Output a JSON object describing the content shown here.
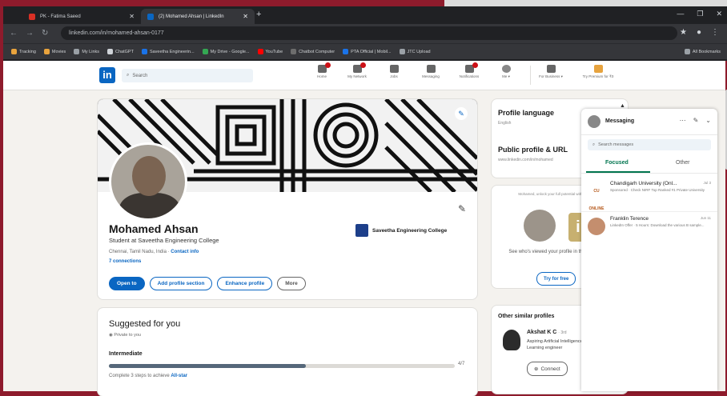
{
  "browser": {
    "tabs": [
      {
        "title": "PK - Fatima Saeed",
        "active": false,
        "color": "#d93025"
      },
      {
        "title": "(2) Mohamed Ahsan | LinkedIn",
        "active": true,
        "color": "#0a66c2"
      }
    ],
    "url": "linkedin.com/in/mohamed-ahsan-0177",
    "bookmarks": [
      "Tracking",
      "Movies",
      "My Links",
      "ChatGPT",
      "Saveetha Engineerin...",
      "My Drive - Google...",
      "YouTube",
      "Chatbot Computer",
      "PTA Official | Mobil...",
      "JTC Upload"
    ],
    "bookmarks_right": "All Bookmarks"
  },
  "linkedin": {
    "logo": "in",
    "search_placeholder": "Search",
    "nav": [
      {
        "label": "Home",
        "badge": true
      },
      {
        "label": "My Network",
        "badge": true
      },
      {
        "label": "Jobs",
        "badge": false
      },
      {
        "label": "Messaging",
        "badge": false
      },
      {
        "label": "Notifications",
        "badge": true
      },
      {
        "label": "Me ▾",
        "badge": false
      },
      {
        "label": "For Business ▾",
        "badge": false
      },
      {
        "label": "Try Premium for ₹0",
        "badge": false
      }
    ],
    "profile": {
      "name": "Mohamed Ahsan",
      "headline": "Student at Saveetha Engineering College",
      "location": "Chennai, Tamil Nadu, India ·",
      "contact_info": "Contact info",
      "connections": "7 connections",
      "college": "Saveetha Engineering College",
      "buttons": [
        "Open to",
        "Add profile section",
        "Enhance profile",
        "More"
      ]
    },
    "suggested": {
      "title": "Suggested for you",
      "private": "Private to you",
      "level": "Intermediate",
      "progress": 0.57,
      "progress_label": "4/7",
      "note": "Complete 3 steps to achieve",
      "note_link": "All-star"
    },
    "sidebar": {
      "profile_language": "Profile language",
      "language": "English",
      "public_profile": "Public profile & URL",
      "public_url": "www.linkedin.com/in/mohamed",
      "premium_note": "Mohamed, unlock your full potential with Premium",
      "premium_desc": "See who's viewed your profile in the last 90 days",
      "premium_button": "Try for free",
      "similar_title": "Other similar profiles",
      "similar_name": "Akshat K C",
      "similar_degree": "· 3rd",
      "similar_desc": "Aspiring Artificial Intelligence and Machine Learning engineer",
      "connect_button": "Connect"
    },
    "messaging": {
      "title": "Messaging",
      "search_placeholder": "Search messages",
      "tabs": [
        "Focused",
        "Other"
      ],
      "threads": [
        {
          "name": "Chandigarh University (Onl...",
          "time": "Jul 3",
          "preview": "Sponsored · Check NIRF Top Ranked #1 Private University",
          "logo": "CU ONLINE"
        },
        {
          "name": "Franklin Terence",
          "time": "Jun 11",
          "preview": "LinkedIn Offer · 5 Hours: Download the various B sample..."
        }
      ]
    }
  }
}
